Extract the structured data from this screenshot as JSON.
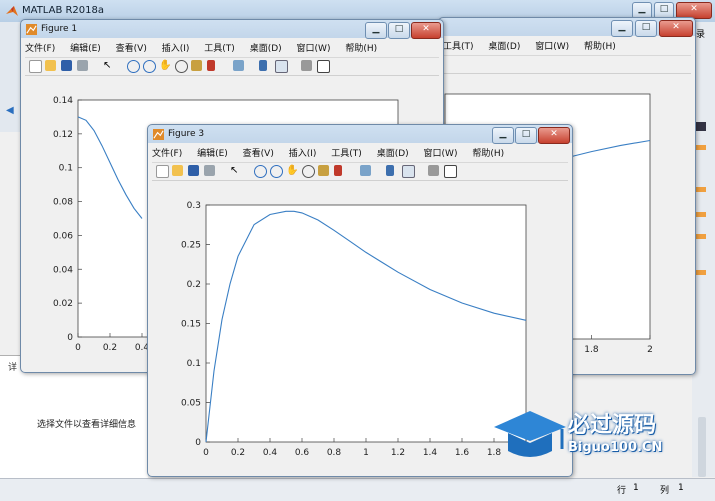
{
  "main": {
    "title": "MATLAB R2018a",
    "left_pane_hint": "选择文件以查看详细信息",
    "side_label": "详",
    "status_row_label": "行",
    "status_row_value": "1",
    "status_col_label": "列",
    "status_col_value": "1",
    "right_hint": "录"
  },
  "figures": {
    "fig1": {
      "title": "Figure 1"
    },
    "fig3": {
      "title": "Figure 3"
    },
    "menu": [
      "文件(F)",
      "编辑(E)",
      "查看(V)",
      "插入(I)",
      "工具(T)",
      "桌面(D)",
      "窗口(W)",
      "帮助(H)"
    ],
    "fig2_menu": [
      "工具(T)",
      "桌面(D)",
      "窗口(W)",
      "帮助(H)"
    ]
  },
  "watermark": {
    "brand_cn": "必过源码",
    "brand_en": "Biguo100.CN"
  },
  "chart_data": [
    {
      "type": "line",
      "id": "figure-3",
      "x": [
        0,
        0.05,
        0.1,
        0.15,
        0.2,
        0.3,
        0.4,
        0.5,
        0.55,
        0.6,
        0.7,
        0.8,
        0.9,
        1.0,
        1.2,
        1.4,
        1.6,
        1.8,
        2.0
      ],
      "y": [
        0,
        0.09,
        0.155,
        0.2,
        0.235,
        0.275,
        0.288,
        0.292,
        0.292,
        0.29,
        0.281,
        0.268,
        0.254,
        0.24,
        0.215,
        0.193,
        0.176,
        0.163,
        0.154
      ],
      "xlim": [
        0,
        2
      ],
      "ylim": [
        0,
        0.3
      ],
      "xticks": [
        "0",
        "0.2",
        "0.4",
        "0.6",
        "0.8",
        "1",
        "1.2",
        "1.4",
        "1.6",
        "1.8",
        "2"
      ],
      "yticks": [
        "0",
        "0.05",
        "0.1",
        "0.15",
        "0.2",
        "0.25",
        "0.3"
      ],
      "color": "#3a7fc4"
    },
    {
      "type": "line",
      "id": "figure-1",
      "x": [
        0,
        0.05,
        0.1,
        0.15,
        0.2,
        0.25,
        0.3,
        0.35,
        0.4
      ],
      "y": [
        0.13,
        0.128,
        0.122,
        0.113,
        0.103,
        0.093,
        0.084,
        0.076,
        0.07
      ],
      "xlim": [
        0,
        2
      ],
      "ylim": [
        0,
        0.14
      ],
      "xticks": [
        "0",
        "0.2",
        "0.4"
      ],
      "yticks": [
        "0",
        "0.02",
        "0.04",
        "0.06",
        "0.08",
        "0.1",
        "0.12",
        "0.14"
      ],
      "color": "#3a7fc4"
    },
    {
      "type": "line",
      "id": "figure-2-partial",
      "x": [
        1.4,
        1.5,
        1.6,
        1.7,
        1.8,
        1.9,
        2.0
      ],
      "y": [
        0.62,
        0.66,
        0.7,
        0.735,
        0.765,
        0.79,
        0.81
      ],
      "xticks": [
        "1.6",
        "1.8",
        "2"
      ],
      "color": "#3a7fc4"
    }
  ]
}
